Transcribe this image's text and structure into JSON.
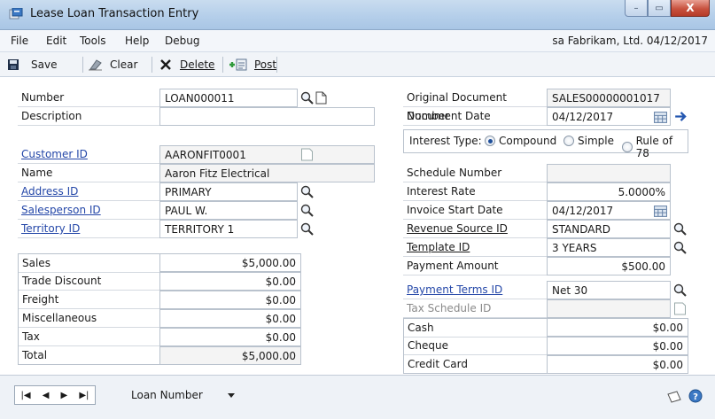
{
  "window": {
    "title": "Lease Loan Transaction Entry",
    "controls": {
      "minimize": "–",
      "maximize": "▭",
      "close": "X"
    }
  },
  "menu": {
    "items": [
      "File",
      "Edit",
      "Tools",
      "Help",
      "Debug"
    ],
    "company": "sa  Fabrikam, Ltd.  04/12/2017"
  },
  "toolbar": {
    "save": "Save",
    "clear": "Clear",
    "delete": "Delete",
    "post": "Post"
  },
  "form": {
    "number_label": "Number",
    "number_value": "LOAN000011",
    "description_label": "Description",
    "description_value": "",
    "customer_id_label": "Customer ID",
    "customer_id_value": "AARONFIT0001",
    "name_label": "Name",
    "name_value": "Aaron Fitz Electrical",
    "address_id_label": "Address ID",
    "address_id_value": "PRIMARY",
    "salesperson_id_label": "Salesperson ID",
    "salesperson_id_value": "PAUL W.",
    "territory_id_label": "Territory ID",
    "territory_id_value": "TERRITORY 1",
    "totals": [
      {
        "label": "Sales",
        "value": "$5,000.00"
      },
      {
        "label": "Trade Discount",
        "value": "$0.00"
      },
      {
        "label": "Freight",
        "value": "$0.00"
      },
      {
        "label": "Miscellaneous",
        "value": "$0.00"
      },
      {
        "label": "Tax",
        "value": "$0.00"
      },
      {
        "label": "Total",
        "value": "$5,000.00"
      }
    ],
    "orig_doc_label": "Original Document Number",
    "orig_doc_value": "SALES00000001017",
    "doc_date_label": "Document Date",
    "doc_date_value": "04/12/2017",
    "interest_type_label": "Interest Type:",
    "interest_options": [
      "Compound",
      "Simple",
      "Rule of 78"
    ],
    "interest_selected": "Compound",
    "schedule_number_label": "Schedule Number",
    "schedule_number_value": "",
    "interest_rate_label": "Interest Rate",
    "interest_rate_value": "5.0000%",
    "invoice_start_label": "Invoice Start Date",
    "invoice_start_value": "04/12/2017",
    "revenue_source_label": "Revenue Source ID",
    "revenue_source_value": "STANDARD",
    "template_id_label": "Template ID",
    "template_id_value": "3 YEARS",
    "payment_amount_label": "Payment Amount",
    "payment_amount_value": "$500.00",
    "payment_terms_label": "Payment Terms ID",
    "payment_terms_value": "Net 30",
    "tax_schedule_label": "Tax Schedule ID",
    "tax_schedule_value": "",
    "payments": [
      {
        "label": "Cash",
        "value": "$0.00"
      },
      {
        "label": "Cheque",
        "value": "$0.00"
      },
      {
        "label": "Credit Card",
        "value": "$0.00"
      }
    ]
  },
  "statusbar": {
    "sort_by": "Loan Number"
  },
  "colors": {
    "link": "#2447a8",
    "titlebar": "#b5cfea",
    "close": "#c8523f"
  }
}
